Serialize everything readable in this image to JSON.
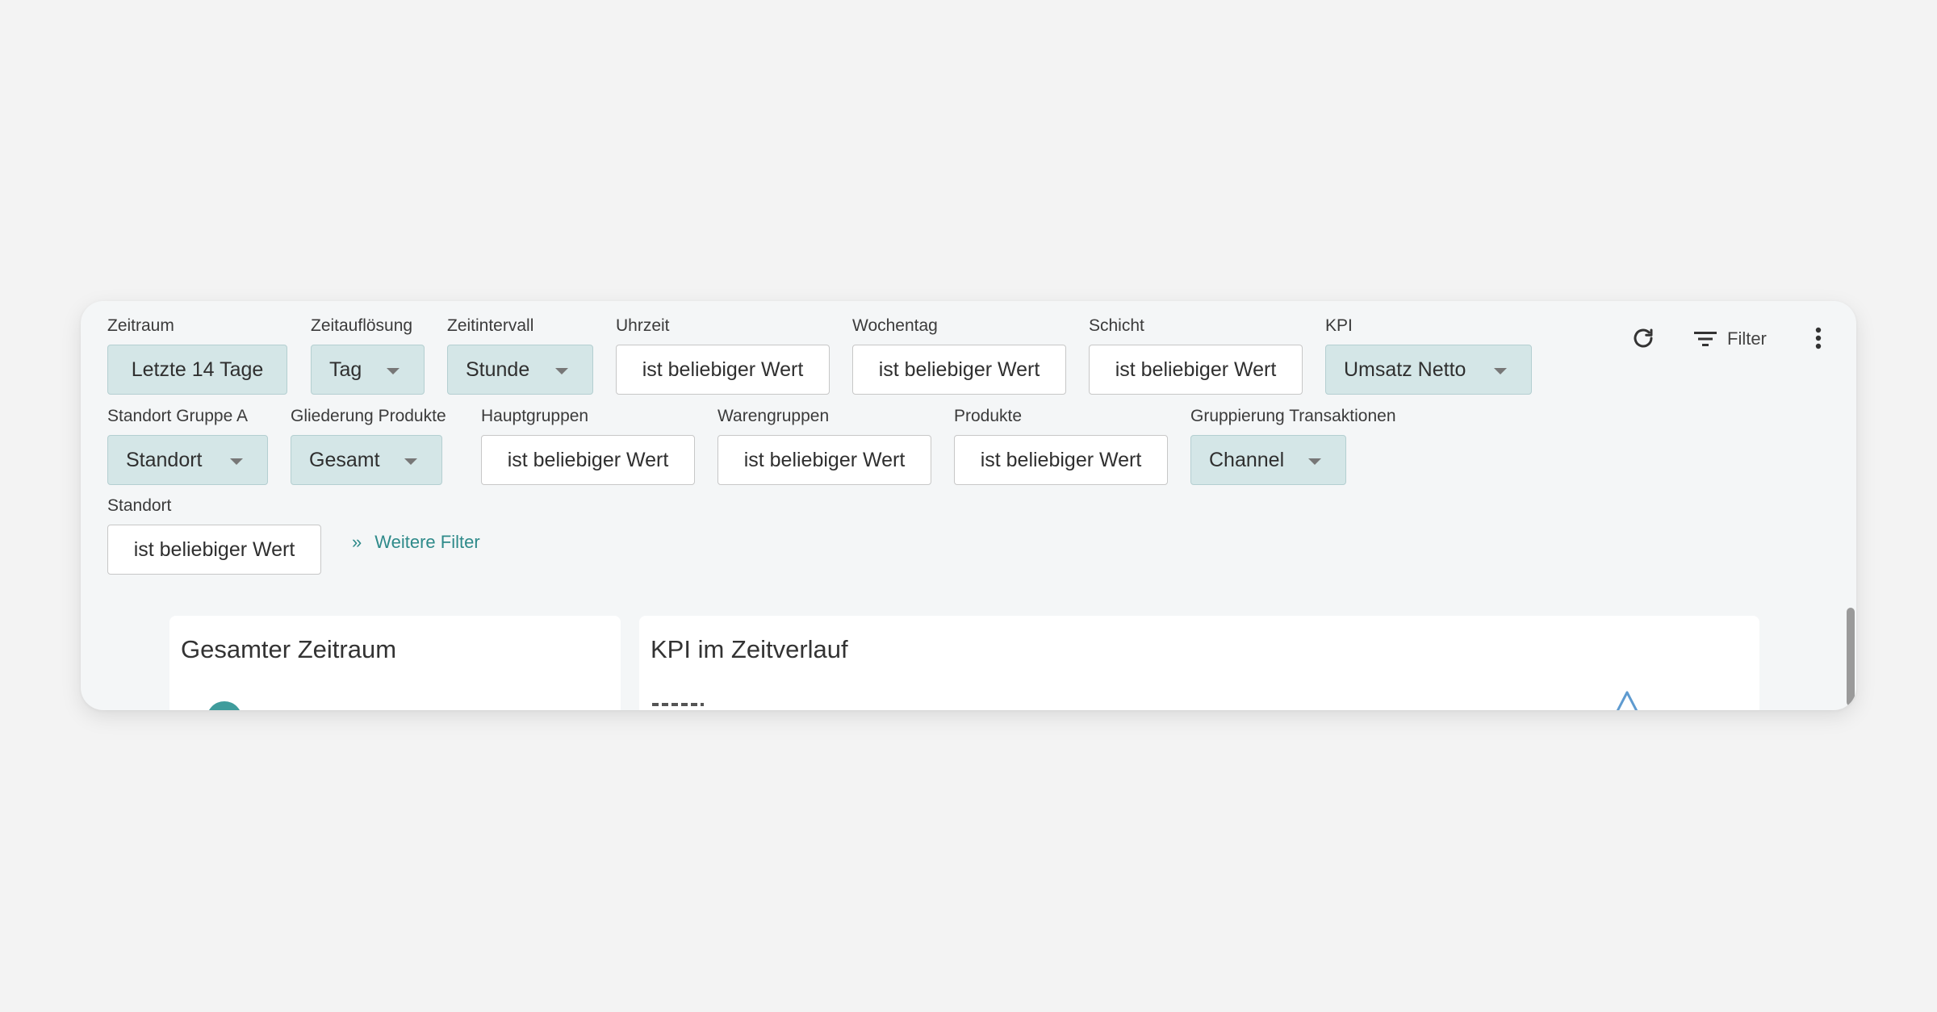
{
  "toolbar": {
    "refresh_icon": "refresh-icon",
    "filter_icon": "filter-icon",
    "filter_label": "Filter",
    "more_icon": "more-vertical-icon"
  },
  "filters": {
    "zeitraum": {
      "label": "Zeitraum",
      "value": "Letzte 14 Tage"
    },
    "zeitaufloesung": {
      "label": "Zeitauflösung",
      "value": "Tag"
    },
    "zeitintervall": {
      "label": "Zeitintervall",
      "value": "Stunde"
    },
    "uhrzeit": {
      "label": "Uhrzeit",
      "value": "ist beliebiger Wert"
    },
    "wochentag": {
      "label": "Wochentag",
      "value": "ist beliebiger Wert"
    },
    "schicht": {
      "label": "Schicht",
      "value": "ist beliebiger Wert"
    },
    "kpi": {
      "label": "KPI",
      "value": "Umsatz Netto"
    },
    "standort_gruppe_a": {
      "label": "Standort Gruppe A",
      "value": "Standort"
    },
    "gliederung_produkte": {
      "label": "Gliederung Produkte",
      "value": "Gesamt"
    },
    "hauptgruppen": {
      "label": "Hauptgruppen",
      "value": "ist beliebiger Wert"
    },
    "warengruppen": {
      "label": "Warengruppen",
      "value": "ist beliebiger Wert"
    },
    "produkte": {
      "label": "Produkte",
      "value": "ist beliebiger Wert"
    },
    "gruppierung_transaktionen": {
      "label": "Gruppierung Transaktionen",
      "value": "Channel"
    },
    "standort": {
      "label": "Standort",
      "value": "ist beliebiger Wert"
    }
  },
  "more_filters": {
    "chevron": "»",
    "label": "Weitere Filter"
  },
  "panels": {
    "gesamter_zeitraum": {
      "title": "Gesamter Zeitraum"
    },
    "kpi_zeitverlauf": {
      "title": "KPI im Zeitverlauf"
    }
  },
  "colors": {
    "accent": "#2e8a8a",
    "dropdown_bg": "#d4e6e7",
    "card_bg": "#f4f6f7",
    "page_bg": "#f3f3f3"
  }
}
